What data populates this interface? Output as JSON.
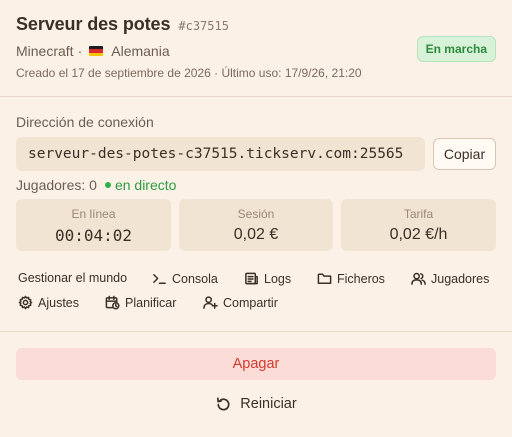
{
  "server": {
    "name": "Serveur des potes",
    "id": "#c37515",
    "game": "Minecraft",
    "separator": "·",
    "country": "Alemania",
    "created_info": "Creado el 17 de septiembre de 2026 · Último uso: 17/9/26, 21:20",
    "status": "En marcha"
  },
  "connection": {
    "label": "Dirección de conexión",
    "address": "serveur-des-potes-c37515.tickserv.com:25565",
    "copy_label": "Copiar"
  },
  "players": {
    "label": "Jugadores: 0",
    "live": "en directo"
  },
  "stats": [
    {
      "label": "En línea",
      "value": "00:04:02"
    },
    {
      "label": "Sesión",
      "value": "0,02 €"
    },
    {
      "label": "Tarifa",
      "value": "0,02 €/h"
    }
  ],
  "actions": {
    "manage_world": "Gestionar el mundo",
    "console": "Consola",
    "logs": "Logs",
    "files": "Ficheros",
    "players": "Jugadores",
    "settings": "Ajustes",
    "schedule": "Planificar",
    "share": "Compartir"
  },
  "buttons": {
    "shutdown": "Apagar",
    "restart": "Reiniciar"
  },
  "colors": {
    "background": "#fbf1e6",
    "status_green": "#2d8a3d",
    "danger": "#d23a2f",
    "danger_bg": "#fcdcd6"
  },
  "icons": {
    "flag": "germany-flag",
    "console": "terminal-icon",
    "logs": "logs-icon",
    "files": "folder-icon",
    "players": "users-icon",
    "settings": "gear-icon",
    "schedule": "calendar-clock-icon",
    "share": "user-plus-icon",
    "restart": "restart-icon"
  }
}
